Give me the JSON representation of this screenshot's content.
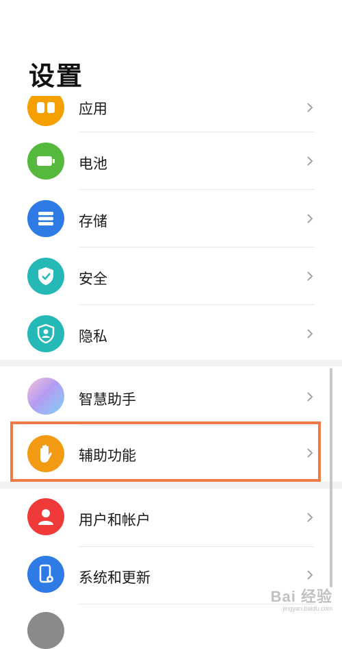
{
  "header": {
    "title": "设置"
  },
  "settings_items": [
    {
      "label": "应用",
      "icon": "apps-icon",
      "color": "#F5A000"
    },
    {
      "label": "电池",
      "icon": "battery-icon",
      "color": "#55B93E"
    },
    {
      "label": "存储",
      "icon": "storage-icon",
      "color": "#2E7BE6"
    },
    {
      "label": "安全",
      "icon": "shield-check-icon",
      "color": "#24B8B6"
    },
    {
      "label": "隐私",
      "icon": "privacy-shield-icon",
      "color": "#24B8B6"
    },
    {
      "label": "智慧助手",
      "icon": "smart-assistant-icon",
      "color": "#9B8DF0"
    },
    {
      "label": "辅助功能",
      "icon": "hand-icon",
      "color": "#F29A12"
    },
    {
      "label": "用户和帐户",
      "icon": "user-icon",
      "color": "#F03A3A"
    },
    {
      "label": "系统和更新",
      "icon": "phone-settings-icon",
      "color": "#2E7BE6"
    }
  ],
  "watermark": {
    "main": "Bai 经验",
    "sub": "jingyan.baidu.com"
  },
  "highlight_color": "#EE7B46"
}
